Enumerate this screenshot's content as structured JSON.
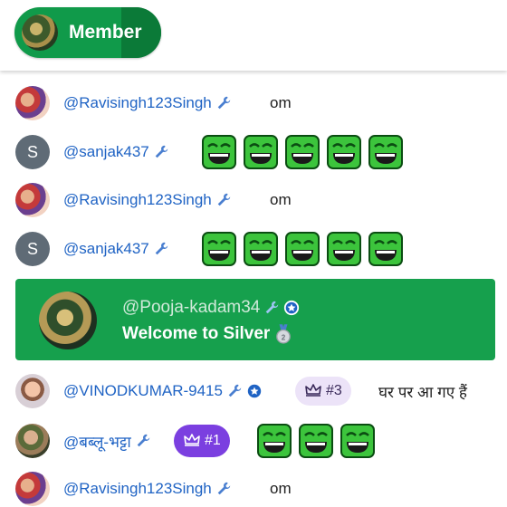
{
  "header": {
    "member_label": "Member",
    "pill_color_left": "#109a4a",
    "pill_color_right": "#0b7a38"
  },
  "messages": [
    {
      "author": "@Ravisingh123Singh",
      "text": "om",
      "avatar": "photo"
    },
    {
      "author": "@sanjak437",
      "avatar_letter": "S",
      "emoji": "rolling-laugh-face",
      "emoji_count": 5
    },
    {
      "author": "@Ravisingh123Singh",
      "text": "om",
      "avatar": "photo"
    },
    {
      "author": "@sanjak437",
      "avatar_letter": "S",
      "emoji": "rolling-laugh-face",
      "emoji_count": 5
    },
    {
      "author": "@VINODKUMAR-9415",
      "badge": "#3",
      "text": "घर पर आ गए हैं",
      "avatar": "photo"
    },
    {
      "author": "@बब्लू-भट्टा",
      "badge": "#1",
      "emoji": "rolling-laugh-face",
      "emoji_count": 3,
      "avatar": "photo"
    },
    {
      "author": "@Ravisingh123Singh",
      "text": "om",
      "avatar": "photo"
    }
  ],
  "welcome": {
    "author": "@Pooja-kadam34",
    "text": "Welcome to Silver",
    "icon": "silver-medal-icon",
    "background": "#16a04d"
  },
  "colors": {
    "author_link": "#1f63c4",
    "badge3_bg": "#ece3f8",
    "badge1_bg": "#7b3fe0",
    "emoji_green": "#3cc43c"
  }
}
